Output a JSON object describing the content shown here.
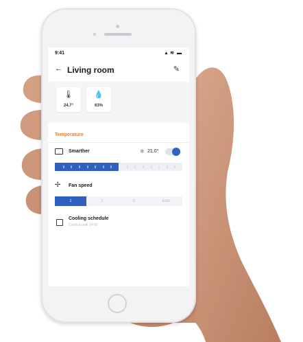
{
  "status_bar": {
    "time": "9:41",
    "icons": "▴ ≋ ▬"
  },
  "header": {
    "back_icon": "arrow-left-icon",
    "title": "Living room",
    "edit_icon": "pencil-icon"
  },
  "sensors": [
    {
      "icon": "thermometer-icon",
      "value": "24.7°"
    },
    {
      "icon": "droplet-icon",
      "value": "63%"
    }
  ],
  "section": {
    "title": "Temperature"
  },
  "smarther": {
    "label": "Smarther",
    "mode_icon": "snowflake-icon",
    "setpoint": "21.0°",
    "toggle_on": true
  },
  "level_bar": {
    "level_fraction": 0.5
  },
  "fan_speed": {
    "label": "Fan speed",
    "options": [
      "1",
      "2",
      "3",
      "auto"
    ],
    "selected_index": 0
  },
  "cooling_schedule": {
    "label": "Cooling schedule",
    "subtitle": "Comfort until 14:00"
  },
  "colors": {
    "accent": "#2f5fbf",
    "section_title": "#f07b2b"
  }
}
